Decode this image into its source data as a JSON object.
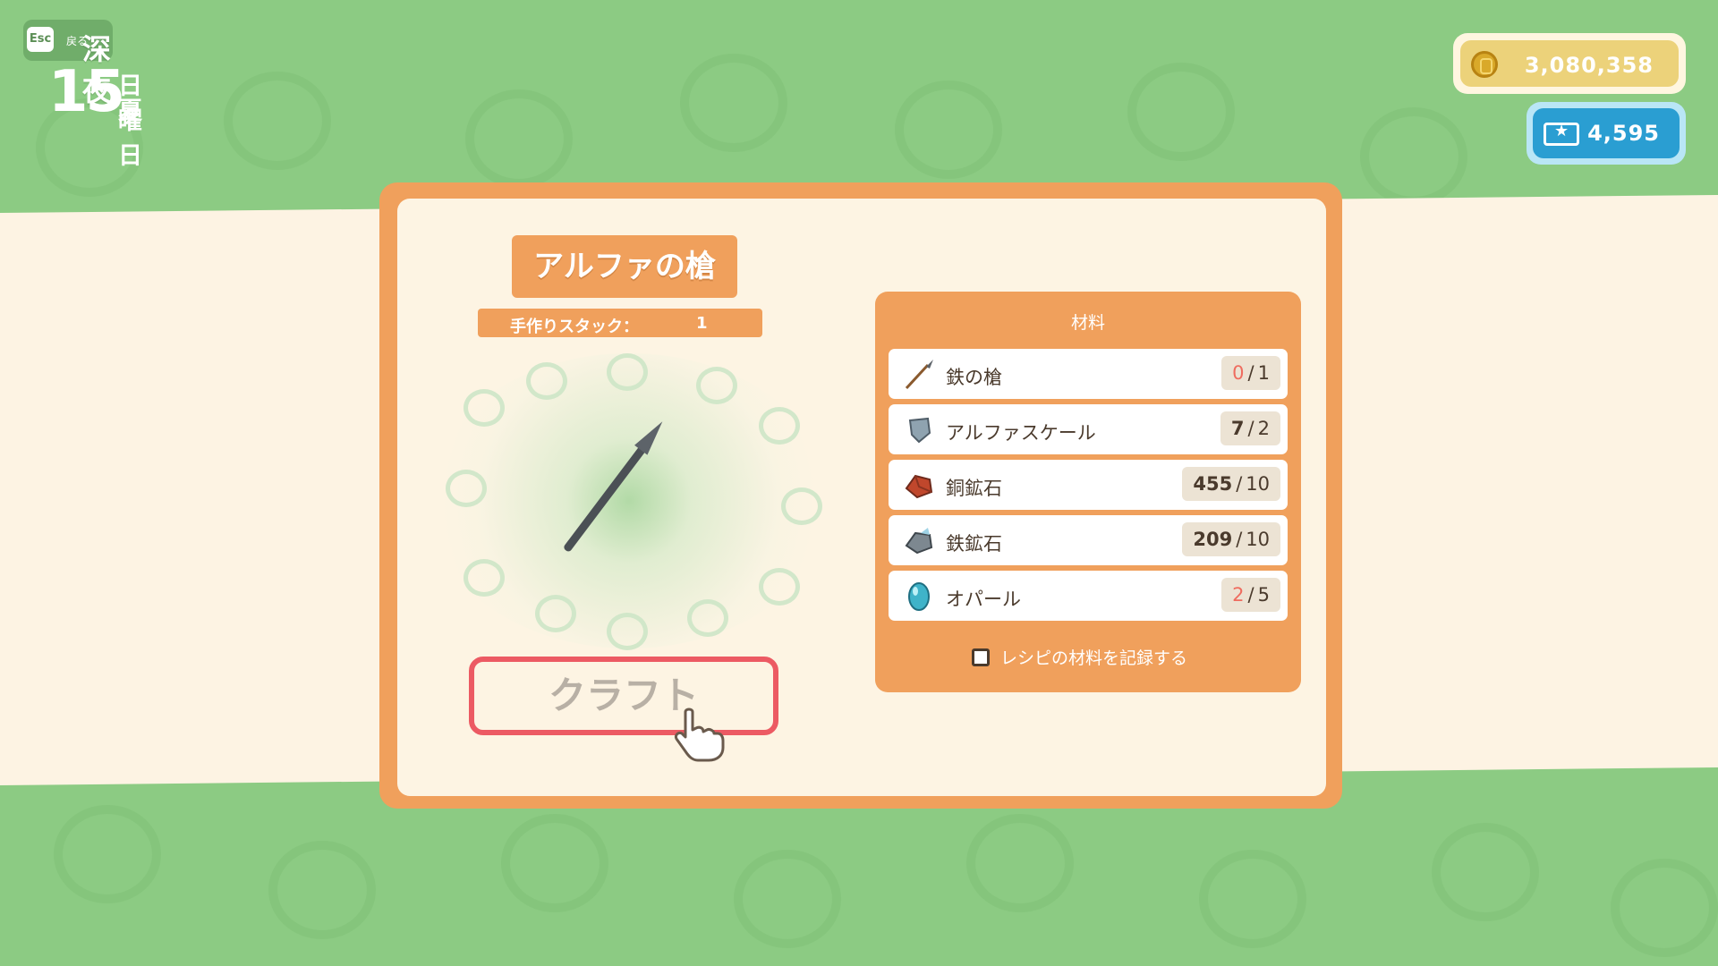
{
  "hud": {
    "esc_key": "Esc",
    "back_label": "戻る",
    "time_of_day": "深夜",
    "day_number": "15",
    "weekday": "日曜日",
    "season": "夏"
  },
  "currency": {
    "gold": "3,080,358",
    "tickets": "4,595"
  },
  "item": {
    "name": "アルファの槍",
    "stack_label": "手作りスタック：",
    "stack_value": "1"
  },
  "craft_button_label": "クラフト",
  "materials": {
    "header": "材料",
    "items": [
      {
        "name": "鉄の槍",
        "have": "0",
        "need": "1",
        "icon": "iron-spear-icon",
        "short": true
      },
      {
        "name": "アルファスケール",
        "have": "7",
        "need": "2",
        "icon": "alpha-scale-icon",
        "short": false
      },
      {
        "name": "銅鉱石",
        "have": "455",
        "need": "10",
        "icon": "copper-ore-icon",
        "short": false
      },
      {
        "name": "鉄鉱石",
        "have": "209",
        "need": "10",
        "icon": "iron-ore-icon",
        "short": false
      },
      {
        "name": "オパール",
        "have": "2",
        "need": "5",
        "icon": "opal-icon",
        "short": true
      }
    ],
    "record_label": "レシピの材料を記録する"
  },
  "colors": {
    "background": "#8ccb83",
    "panel": "#f0a05c",
    "panel_inner": "#fdf4e3",
    "craft_border": "#ec5a63",
    "shortage": "#ef6c5f",
    "gold": "#ecd27a",
    "ticket": "#2a9ed2"
  }
}
